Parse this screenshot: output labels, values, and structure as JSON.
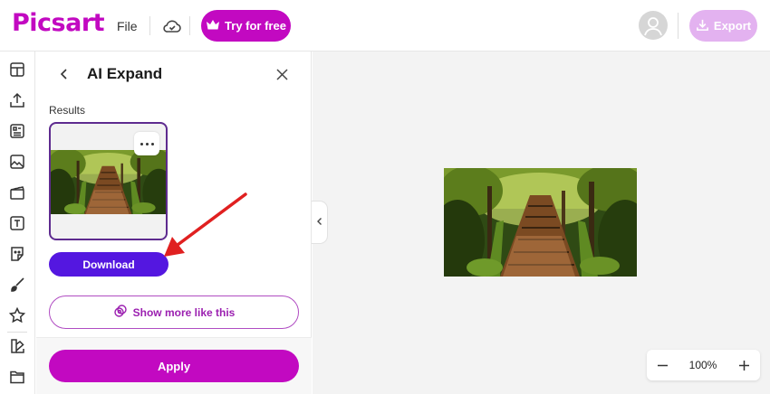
{
  "header": {
    "logo_text": "Picsart",
    "file_menu": "File",
    "try_button": "Try for free",
    "export_button": "Export",
    "brand_color": "#c209c1"
  },
  "rail": {
    "icons": [
      "layout-icon",
      "upload-icon",
      "templates-icon",
      "photos-icon",
      "video-icon",
      "text-icon",
      "stickers-icon",
      "brush-icon",
      "star-icon",
      "shapes-icon",
      "folder-icon"
    ]
  },
  "panel": {
    "title": "AI Expand",
    "results_label": "Results",
    "download_button": "Download",
    "show_more_button": "Show more like this",
    "apply_button": "Apply"
  },
  "zoom": {
    "value": "100%"
  },
  "colors": {
    "accent": "#c209c1",
    "download": "#5417e0",
    "selected_border": "#5e2b8f",
    "annotation_arrow": "#e02020"
  }
}
